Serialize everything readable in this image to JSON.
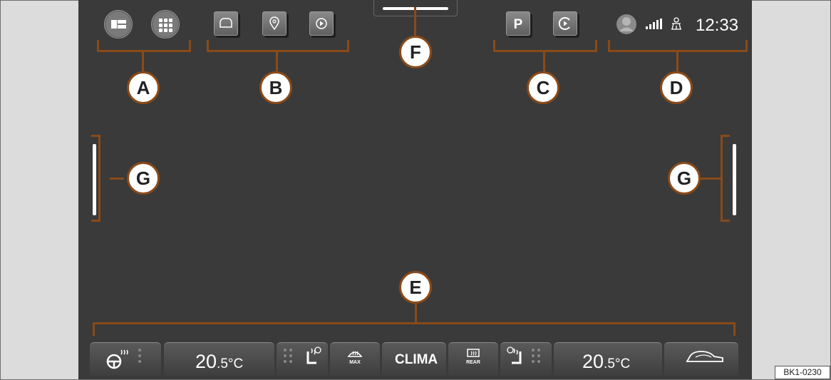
{
  "status_bar": {
    "time": "12:33"
  },
  "icons": {
    "home": "layout-icon",
    "apps": "app-grid-icon",
    "favorites": [
      "car-icon",
      "location-pin-icon",
      "play-icon"
    ],
    "shortcuts": [
      "parking-icon",
      "connect-icon"
    ],
    "profile": "user-avatar-icon",
    "signal": "signal-bars-icon",
    "traffic": "traffic-icon"
  },
  "callouts": {
    "a": "A",
    "b": "B",
    "c": "C",
    "d": "D",
    "e": "E",
    "f": "F",
    "g_left": "G",
    "g_right": "G"
  },
  "climate": {
    "left_temp_main": "20",
    "left_temp_fraction": ".5",
    "left_unit": "°C",
    "right_temp_main": "20",
    "right_temp_fraction": ".5",
    "right_unit": "°C",
    "max_label": "MAX",
    "clima_label": "CLIMA",
    "rear_label": "REAR"
  },
  "figure_code": "BK1-0230",
  "colors": {
    "screen": "#3a3a3a",
    "callout_border": "#8a4a18",
    "text": "#ffffff"
  }
}
